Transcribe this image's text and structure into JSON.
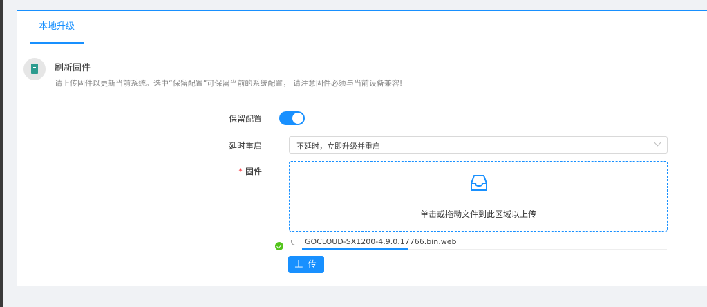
{
  "tabs": [
    {
      "label": "本地升级",
      "active": true
    }
  ],
  "section": {
    "icon": "firmware-chip-icon",
    "title": "刷新固件",
    "description": "请上传固件以更新当前系统。选中“保留配置”可保留当前的系统配置， 请注意固件必须与当前设备兼容!"
  },
  "form": {
    "keep_config": {
      "label": "保留配置",
      "enabled": true
    },
    "delay_reboot": {
      "label": "延时重启",
      "value": "不延时，立即升级并重启"
    },
    "firmware": {
      "required_mark": "*",
      "label": "固件",
      "dropzone_icon": "inbox-icon",
      "dropzone_hint": "单击或拖动文件到此区域以上传",
      "file": {
        "name": "GOCLOUD-SX1200-4.9.0.17766.bin.web",
        "status": "success",
        "progress": 0.29
      }
    },
    "upload_button": "上 传"
  },
  "colors": {
    "accent": "#1890ff",
    "success": "#52c41a",
    "required": "#f5222d",
    "chip": "#2d9c8f"
  }
}
